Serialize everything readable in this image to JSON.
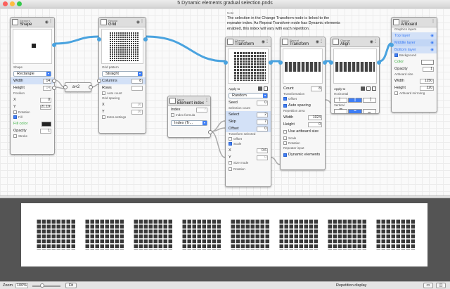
{
  "window": {
    "title": "5 Dynamic elements gradual selection.pnds"
  },
  "note": {
    "header": "Note",
    "text": "The selection in the Change Transform node is linked to the repeater index. As Repeat Transform node has Dynamic elements enabled, this index will vary with each repetition."
  },
  "nodes": {
    "shape": {
      "category": "Element",
      "name": "Shape",
      "shape_label": "Shape",
      "shape_value": "Rectangle",
      "width_label": "Width",
      "width": "14",
      "height_label": "Height",
      "height": "14",
      "position_label": "Position",
      "x_label": "X",
      "x": "0",
      "y_label": "Y",
      "y": "21.19",
      "rotation_label": "Rotation",
      "fill_label": "Fill",
      "fill_color_label": "Fill color",
      "opacity_label": "Opacity",
      "opacity": "1",
      "stroke_label": "Stroke"
    },
    "math": {
      "label": "a+2"
    },
    "repeat_grid": {
      "category": "Repeat",
      "name": "Grid",
      "pattern_label": "Grid pattern",
      "pattern_value": "Straight",
      "columns_label": "Columns",
      "columns": "8",
      "rows_label": "Rows",
      "rows": "",
      "autocount_label": "Auto count",
      "spacing_label": "Grid spacing",
      "x_label": "X",
      "x": "16",
      "y_label": "Y",
      "y": "16",
      "extra_label": "Extra settings"
    },
    "element_index": {
      "category": "Value",
      "name": "Element index",
      "index_label": "Index",
      "index": "7",
      "formula_label": "Index formula",
      "select_value": "Index (Tr..."
    },
    "change_transform": {
      "category": "Change",
      "name": "Transform",
      "apply_label": "Apply to",
      "mode_value": "Random",
      "seed_label": "Seed",
      "seed": "0",
      "selcount_label": "Selection count",
      "select_label": "Select",
      "select": "2",
      "skip_label": "Skip",
      "skip": "7",
      "offset_label": "Offset",
      "offset": "0",
      "transform_label": "Transform selected",
      "t_offset_label": "Offset",
      "t_scale_label": "Scale",
      "x_label": "X",
      "x": "0.6",
      "y_label": "Y",
      "y": "0",
      "sizemode_label": "Size mode",
      "rotation_label": "Rotation"
    },
    "repeat_transform": {
      "category": "Repeat",
      "name": "Transform",
      "count_label": "Count",
      "count": "8",
      "transformation_label": "Transformation",
      "offset_label": "Offset",
      "autospacing_label": "Auto spacing",
      "area_label": "Repetition area",
      "width_label": "Width",
      "width": "1024",
      "height_label": "Height",
      "height": "0",
      "useart_label": "Use artboard size",
      "scale_label": "Scale",
      "rotation_label": "Rotation",
      "input_label": "Repeater input",
      "dynamic_label": "Dynamic elements"
    },
    "change_align": {
      "category": "Change",
      "name": "Align",
      "apply_label": "Apply to",
      "horizontal_label": "Horizontal",
      "vertical_label": "Vertical"
    },
    "artboard": {
      "category": "Output",
      "name": "Artboard",
      "layers_label": "Graphics layers",
      "layers": [
        "Top layer",
        "Middle layer",
        "Bottom layer"
      ],
      "background_label": "Background",
      "color_label": "Color",
      "opacity_label": "Opacity",
      "opacity": "1",
      "size_label": "Artboard size",
      "width_label": "Width",
      "width": "1250",
      "height_label": "Height",
      "height": "220",
      "mirroring_label": "Artboard mirroring"
    }
  },
  "status": {
    "zoom_label": "Zoom",
    "zoom": "100%",
    "fit_label": "Fit",
    "repetition_label": "Repetition display",
    "zoom_fraction": 0.35
  },
  "colors": {
    "wire": "#4aa3df",
    "accent": "#3d7df5",
    "green": "#3cb043"
  }
}
